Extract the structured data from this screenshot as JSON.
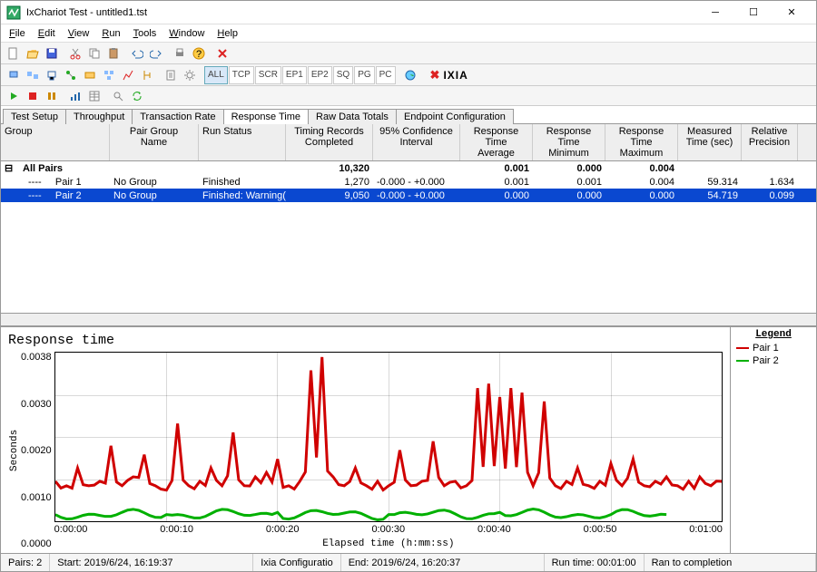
{
  "window": {
    "title": "IxChariot Test - untitled1.tst"
  },
  "menu": {
    "items": [
      "File",
      "Edit",
      "View",
      "Run",
      "Tools",
      "Window",
      "Help"
    ]
  },
  "toolbar2": {
    "buttons": [
      "ALL",
      "TCP",
      "SCR",
      "EP1",
      "EP2",
      "SQ",
      "PG",
      "PC"
    ],
    "selected": "ALL",
    "brand": "IXIA"
  },
  "tabs": {
    "items": [
      "Test Setup",
      "Throughput",
      "Transaction Rate",
      "Response Time",
      "Raw Data Totals",
      "Endpoint Configuration"
    ],
    "active": 3
  },
  "grid": {
    "headers": {
      "group": "Group",
      "pgn": "Pair Group\nName",
      "run": "Run Status",
      "tr": "Timing Records\nCompleted",
      "ci": "95% Confidence\nInterval",
      "ra": "Response Time\nAverage",
      "rmin": "Response Time\nMinimum",
      "rmax": "Response Time\nMaximum",
      "mt": "Measured\nTime (sec)",
      "rp": "Relative\nPrecision"
    },
    "summary": {
      "label": "All Pairs",
      "tr": "10,320",
      "ra": "0.001",
      "rmin": "0.000",
      "rmax": "0.004"
    },
    "rows": [
      {
        "pair": "Pair 1",
        "pgn": "No Group",
        "run": "Finished",
        "tr": "1,270",
        "ci": "-0.000 - +0.000",
        "ra": "0.001",
        "rmin": "0.001",
        "rmax": "0.004",
        "mt": "59.314",
        "rp": "1.634",
        "sel": false
      },
      {
        "pair": "Pair 2",
        "pgn": "No Group",
        "run": "Finished: Warning(s)",
        "tr": "9,050",
        "ci": "-0.000 - +0.000",
        "ra": "0.000",
        "rmin": "0.000",
        "rmax": "0.000",
        "mt": "54.719",
        "rp": "0.099",
        "sel": true
      }
    ]
  },
  "chart_data": {
    "type": "line",
    "title": "Response time",
    "xlabel": "Elapsed time (h:mm:ss)",
    "ylabel": "Seconds",
    "ylim": [
      0,
      0.0038
    ],
    "yticks": [
      "0.0000",
      "0.0010",
      "0.0020",
      "0.0030",
      "0.0038"
    ],
    "xticks": [
      "0:00:00",
      "0:00:10",
      "0:00:20",
      "0:00:30",
      "0:00:40",
      "0:00:50",
      "0:01:00"
    ],
    "legend_title": "Legend",
    "series": [
      {
        "name": "Pair 1",
        "color": "#d00000",
        "baseline": 0.0008,
        "points": [
          [
            0,
            0.0009
          ],
          [
            1,
            0.0008
          ],
          [
            2,
            0.0012
          ],
          [
            3,
            0.0008
          ],
          [
            4,
            0.0009
          ],
          [
            5,
            0.0017
          ],
          [
            6,
            0.0008
          ],
          [
            7,
            0.001
          ],
          [
            8,
            0.0015
          ],
          [
            9,
            0.0008
          ],
          [
            10,
            0.0007
          ],
          [
            11,
            0.0022
          ],
          [
            12,
            0.0008
          ],
          [
            13,
            0.0009
          ],
          [
            14,
            0.0012
          ],
          [
            15,
            0.0008
          ],
          [
            16,
            0.002
          ],
          [
            17,
            0.0008
          ],
          [
            18,
            0.001
          ],
          [
            19,
            0.0011
          ],
          [
            20,
            0.0014
          ],
          [
            21,
            0.0008
          ],
          [
            22,
            0.0009
          ],
          [
            23,
            0.0034
          ],
          [
            24,
            0.0037
          ],
          [
            25,
            0.001
          ],
          [
            26,
            0.0008
          ],
          [
            27,
            0.0012
          ],
          [
            28,
            0.0008
          ],
          [
            29,
            0.0009
          ],
          [
            30,
            0.0008
          ],
          [
            31,
            0.0016
          ],
          [
            32,
            0.0008
          ],
          [
            33,
            0.0009
          ],
          [
            34,
            0.0018
          ],
          [
            35,
            0.0008
          ],
          [
            36,
            0.0009
          ],
          [
            37,
            0.0008
          ],
          [
            38,
            0.003
          ],
          [
            39,
            0.0031
          ],
          [
            40,
            0.0028
          ],
          [
            41,
            0.003
          ],
          [
            42,
            0.0029
          ],
          [
            43,
            0.0008
          ],
          [
            44,
            0.0027
          ],
          [
            45,
            0.0008
          ],
          [
            46,
            0.0009
          ],
          [
            47,
            0.0012
          ],
          [
            48,
            0.0008
          ],
          [
            49,
            0.0009
          ],
          [
            50,
            0.0013
          ],
          [
            51,
            0.0008
          ],
          [
            52,
            0.0014
          ],
          [
            53,
            0.0008
          ],
          [
            54,
            0.0009
          ],
          [
            55,
            0.001
          ],
          [
            56,
            0.0008
          ],
          [
            57,
            0.0009
          ],
          [
            58,
            0.001
          ],
          [
            59,
            0.0008
          ],
          [
            60,
            0.0009
          ]
        ]
      },
      {
        "name": "Pair 2",
        "color": "#00b000",
        "baseline": 0.00015,
        "points": [
          [
            0,
            0.00015
          ],
          [
            10,
            0.00015
          ],
          [
            20,
            0.0002
          ],
          [
            30,
            0.00015
          ],
          [
            40,
            0.0002
          ],
          [
            50,
            0.00015
          ],
          [
            55,
            0.00015
          ]
        ]
      }
    ]
  },
  "status": {
    "pairs": "Pairs: 2",
    "start": "Start: 2019/6/24, 16:19:37",
    "cfg": "Ixia Configuratio",
    "end": "End: 2019/6/24, 16:20:37",
    "runtime": "Run time: 00:01:00",
    "ran": "Ran to completion"
  }
}
